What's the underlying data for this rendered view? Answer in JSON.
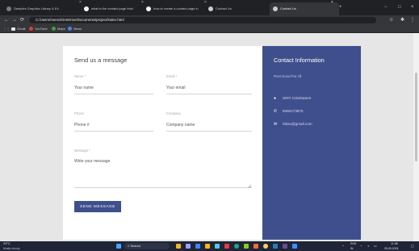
{
  "browser": {
    "tabs": [
      {
        "label": "Samples Graphics Library & Ex",
        "active": false
      },
      {
        "label": "what is the contact page html",
        "active": false
      },
      {
        "label": "how to create a contact page in",
        "active": false
      },
      {
        "label": "Contact Us",
        "active": false
      },
      {
        "label": "Contact Us",
        "active": true
      }
    ],
    "url": "C:/Users/meera/OneDrive/Documents/project/index.html",
    "bookmarks": [
      "Gmail",
      "YouTube",
      "Maps",
      "News"
    ],
    "nav": {
      "back": "←",
      "forward": "→",
      "reload": "⟳",
      "new_tab": "+",
      "min": "−",
      "max": "□",
      "close": "×"
    }
  },
  "form": {
    "title": "Send us a message",
    "fields": {
      "name": {
        "label": "Name *",
        "placeholder": "Your name"
      },
      "email": {
        "label": "Email *",
        "placeholder": "Your email"
      },
      "phone": {
        "label": "Phone",
        "placeholder": "Phone #"
      },
      "company": {
        "label": "Company",
        "placeholder": "Company name"
      },
      "message": {
        "label": "Message *",
        "placeholder": "Write your message"
      }
    },
    "submit_label": "SEND MESSAGE"
  },
  "contact": {
    "title": "Contact Information",
    "subtitle": "Post Good For All",
    "location": "SRIT Coimbatore",
    "phone": "9360173875",
    "email": "hibsu@gmail.com"
  },
  "taskbar": {
    "weather_temp": "29°C",
    "weather_text": "Mostly cloudy",
    "search": "Search",
    "lang": "ENG",
    "region": "IN",
    "time": "11:56",
    "date": "25-03-2024"
  },
  "colors": {
    "accent": "#3f4f8d",
    "chrome_dark": "#202124"
  }
}
